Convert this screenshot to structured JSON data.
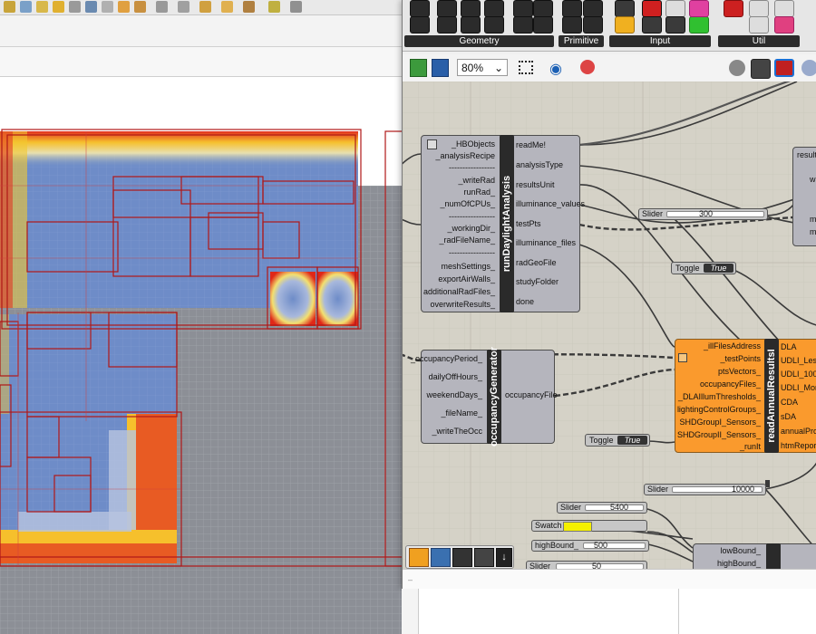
{
  "grasshopper": {
    "ribbon_panels": [
      "Geometry",
      "Primitive",
      "Input",
      "Util"
    ],
    "zoom": "80%",
    "components": {
      "daylight": {
        "name": "runDaylightAnalysis",
        "inputs": [
          "_HBObjects",
          "_analysisRecipe",
          "-----------------",
          "_writeRad",
          "runRad_",
          "_numOfCPUs_",
          "-----------------",
          "_workingDir_",
          "_radFileName_",
          "-----------------",
          "meshSettings_",
          "exportAirWalls_",
          "additionalRadFiles_",
          "overwriteResults_"
        ],
        "outputs": [
          "readMe!",
          "analysisType",
          "resultsUnit",
          "illuminance_values",
          "testPts",
          "illuminance_files",
          "radGeoFile",
          "studyFolder",
          "done"
        ]
      },
      "occupancy": {
        "name": "occupancyGenerator",
        "inputs": [
          "_occupancyPeriod_",
          "dailyOffHours_",
          "weekendDays_",
          "_fileName_",
          "_writeTheOcc"
        ],
        "outputs": [
          "occupancyFile"
        ]
      },
      "annual": {
        "name": "readAnnualResultsI",
        "inputs": [
          "_illFilesAddress",
          "_testPoints",
          "ptsVectors_",
          "occupancyFiles_",
          "_DLAIllumThresholds_",
          "lightingControlGroups_",
          "SHDGroupI_Sensors_",
          "SHDGroupII_Sensors_",
          "_runIt"
        ],
        "outputs": [
          "DLA",
          "UDLI_Less_1",
          "UDLI_100_2",
          "UDLI_More_",
          "CDA",
          "sDA",
          "annualProfil",
          "htmReport"
        ]
      },
      "partial_top": {
        "name": "resultF",
        "labels": [
          "w",
          "m",
          "ma"
        ]
      },
      "bounds": {
        "inputs": [
          "lowBound_",
          "highBound_"
        ]
      }
    },
    "sliders": [
      {
        "label": "Slider",
        "value": "300"
      },
      {
        "label": "Slider",
        "value": "10000"
      },
      {
        "label": "Slider",
        "value": "5400"
      },
      {
        "label": "highBound_",
        "value": "500"
      },
      {
        "label": "Slider",
        "value": "50"
      }
    ],
    "toggles": [
      {
        "label": "Toggle",
        "value": "True"
      },
      {
        "label": "Toggle",
        "value": "True"
      }
    ],
    "swatch": {
      "label": "Swatch",
      "color": "#f5f000"
    },
    "colors": {
      "canvas": "#d5d2c7",
      "component": "#b5b5bd",
      "component_orange": "#fa9a2d",
      "spine": "#2a2a2a"
    }
  }
}
